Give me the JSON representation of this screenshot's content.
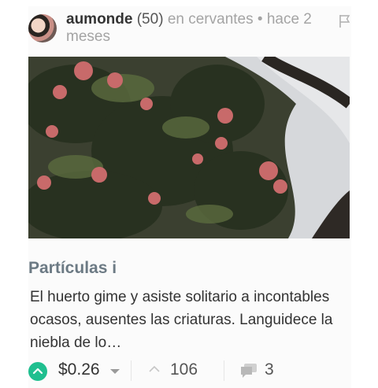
{
  "post": {
    "author": "aumonde",
    "reputation": "(50)",
    "community_prefix": "en",
    "community": "cervantes",
    "separator": "•",
    "time": "hace 2 meses",
    "title": "Partículas i",
    "excerpt": "El huerto gime y asiste solitario a incontables ocasos, ausentes las criaturas. Languidece la niebla de lo…",
    "payout": "$0.26",
    "votes": "106",
    "comments": "3"
  },
  "icons": {
    "flag": "flag-icon",
    "upvote": "upvote-icon",
    "votes": "chevron-up-icon",
    "comments": "comments-icon",
    "payout_dropdown": "caret-down-icon"
  },
  "colors": {
    "upvote_green": "#1fbf8f",
    "title": "#6c7a84",
    "muted": "#a4a4a4"
  }
}
